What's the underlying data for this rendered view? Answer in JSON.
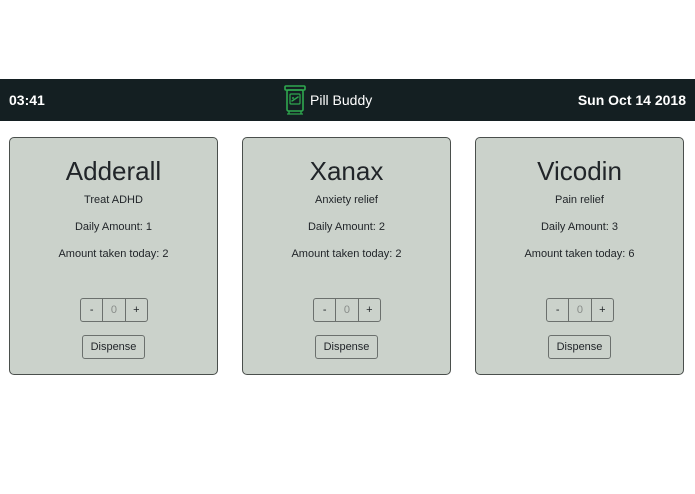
{
  "header": {
    "time": "03:41",
    "brand": "Pill Buddy",
    "date": "Sun Oct 14 2018",
    "logo_icon": "pill-bottle-icon",
    "logo_color": "#2fa84f"
  },
  "cards": [
    {
      "name": "Adderall",
      "purpose": "Treat ADHD",
      "daily": "Daily Amount: 1",
      "taken": "Amount taken today: 2",
      "minus": "-",
      "count": "0",
      "plus": "+",
      "dispense": "Dispense"
    },
    {
      "name": "Xanax",
      "purpose": "Anxiety relief",
      "daily": "Daily Amount: 2",
      "taken": "Amount taken today: 2",
      "minus": "-",
      "count": "0",
      "plus": "+",
      "dispense": "Dispense"
    },
    {
      "name": "Vicodin",
      "purpose": "Pain relief",
      "daily": "Daily Amount: 3",
      "taken": "Amount taken today: 6",
      "minus": "-",
      "count": "0",
      "plus": "+",
      "dispense": "Dispense"
    }
  ],
  "colors": {
    "header_bg": "#141f22",
    "card_bg": "#cbd2cb",
    "card_border": "#4a4f4c"
  }
}
